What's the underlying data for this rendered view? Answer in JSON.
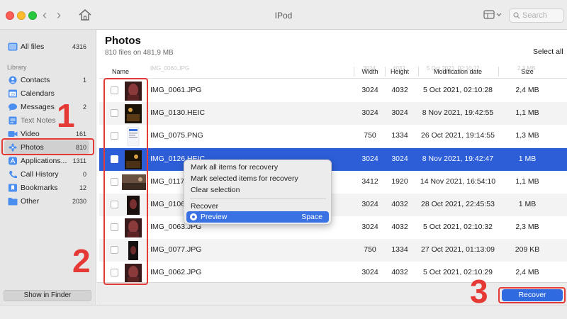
{
  "window": {
    "title": "IPod",
    "search_placeholder": "Search"
  },
  "sidebar": {
    "all_files": {
      "label": "All files",
      "count": "4316"
    },
    "library_heading": "Library",
    "items": [
      {
        "label": "Contacts",
        "count": "1",
        "icon": "contacts-icon",
        "color": "#3b82f6"
      },
      {
        "label": "Calendars",
        "count": "",
        "icon": "calendar-icon",
        "color": "#3b82f6"
      },
      {
        "label": "Messages",
        "count": "2",
        "icon": "messages-icon",
        "color": "#3b82f6"
      },
      {
        "label": "Text Notes",
        "count": "",
        "icon": "notes-icon",
        "color": "#3b82f6"
      },
      {
        "label": "Video",
        "count": "161",
        "icon": "video-icon",
        "color": "#3b82f6"
      },
      {
        "label": "Photos",
        "count": "810",
        "icon": "photos-icon",
        "color": "#3b82f6"
      },
      {
        "label": "Applications...",
        "count": "1311",
        "icon": "applications-icon",
        "color": "#3b82f6"
      },
      {
        "label": "Call History",
        "count": "0",
        "icon": "phone-icon",
        "color": "#3b82f6"
      },
      {
        "label": "Bookmarks",
        "count": "12",
        "icon": "bookmark-icon",
        "color": "#3b82f6"
      },
      {
        "label": "Other",
        "count": "2030",
        "icon": "folder-icon",
        "color": "#3b82f6"
      }
    ],
    "active_item": "Photos",
    "show_in_finder": "Show in Finder"
  },
  "main": {
    "title": "Photos",
    "subtitle": "810 files on 481,9 MB",
    "select_all": "Select all",
    "columns": {
      "name": "Name",
      "width": "Width",
      "height": "Height",
      "modified": "Modification date",
      "size": "Size"
    },
    "ghost_row": {
      "name": "IMG_0060.JPG",
      "width": "3024",
      "height": "4032",
      "modified": "5 Oct 2021, 02:10:22",
      "size": "2,3 MB"
    },
    "rows": [
      {
        "name": "IMG_0061.JPG",
        "width": "3024",
        "height": "4032",
        "modified": "5 Oct 2021, 02:10:28",
        "size": "2,4 MB",
        "thumb": "dark-red"
      },
      {
        "name": "IMG_0130.HEIC",
        "width": "3024",
        "height": "3024",
        "modified": "8 Nov 2021, 19:42:55",
        "size": "1,1 MB",
        "thumb": "night"
      },
      {
        "name": "IMG_0075.PNG",
        "width": "750",
        "height": "1334",
        "modified": "26 Oct 2021, 19:14:55",
        "size": "1,3 MB",
        "thumb": "screenshot"
      },
      {
        "name": "IMG_0126.HEIC",
        "width": "3024",
        "height": "3024",
        "modified": "8 Nov 2021, 19:42:47",
        "size": "1 MB",
        "thumb": "night",
        "selected": true
      },
      {
        "name": "IMG_0117.HEIC",
        "width": "3412",
        "height": "1920",
        "modified": "14 Nov 2021, 16:54:10",
        "size": "1,1 MB",
        "thumb": "wide"
      },
      {
        "name": "IMG_0106.HEIC",
        "width": "3024",
        "height": "4032",
        "modified": "28 Oct 2021, 22:45:53",
        "size": "1 MB",
        "thumb": "dark"
      },
      {
        "name": "IMG_0063.JPG",
        "width": "3024",
        "height": "4032",
        "modified": "5 Oct 2021, 02:10:32",
        "size": "2,3 MB",
        "thumb": "dark-red"
      },
      {
        "name": "IMG_0077.JPG",
        "width": "750",
        "height": "1334",
        "modified": "27 Oct 2021, 01:13:09",
        "size": "209 KB",
        "thumb": "dark"
      },
      {
        "name": "IMG_0062.JPG",
        "width": "3024",
        "height": "4032",
        "modified": "5 Oct 2021, 02:10:29",
        "size": "2,4 MB",
        "thumb": "dark-red"
      }
    ]
  },
  "context_menu": {
    "items": [
      "Mark all items for recovery",
      "Mark selected items for recovery",
      "Clear selection",
      "Recover"
    ],
    "highlighted": {
      "label": "Preview",
      "shortcut": "Space"
    }
  },
  "footer": {
    "recover": "Recover"
  },
  "annotations": {
    "one": "1",
    "two": "2",
    "three": "3",
    "color": "#e53935"
  },
  "colors": {
    "selection": "#2d5ed8",
    "accent": "#2f6ae0"
  }
}
